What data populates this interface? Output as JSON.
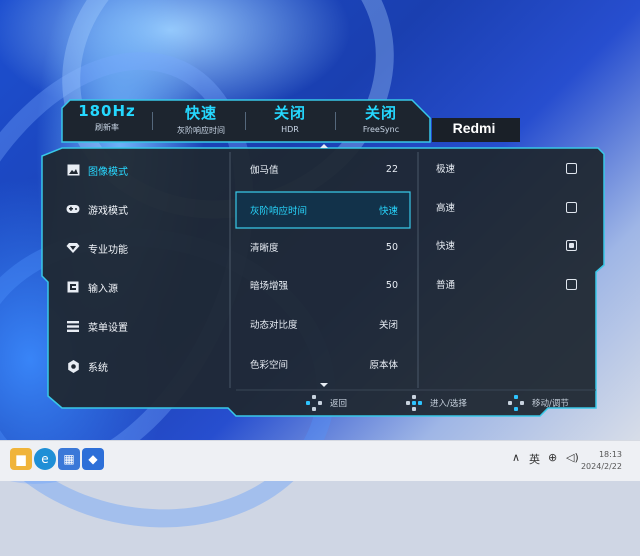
{
  "header_tabs": [
    {
      "value": "180Hz",
      "label": "刷新率"
    },
    {
      "value": "快速",
      "label": "灰阶响应时间"
    },
    {
      "value": "关闭",
      "label": "HDR"
    },
    {
      "value": "关闭",
      "label": "FreeSync"
    }
  ],
  "brand": "Redmi",
  "sidebar": [
    {
      "label": "图像模式",
      "icon": "image-icon",
      "active": true
    },
    {
      "label": "游戏模式",
      "icon": "gamepad-icon",
      "active": false
    },
    {
      "label": "专业功能",
      "icon": "diamond-icon",
      "active": false
    },
    {
      "label": "输入源",
      "icon": "input-source-icon",
      "active": false
    },
    {
      "label": "菜单设置",
      "icon": "menu-icon",
      "active": false
    },
    {
      "label": "系统",
      "icon": "settings-gear-icon",
      "active": false
    }
  ],
  "settings": [
    {
      "label": "伽马值",
      "value": "22"
    },
    {
      "label": "灰阶响应时间",
      "value": "快速"
    },
    {
      "label": "清晰度",
      "value": "50"
    },
    {
      "label": "暗场增强",
      "value": "50"
    },
    {
      "label": "动态对比度",
      "value": "关闭"
    },
    {
      "label": "色彩空间",
      "value": "原本体"
    }
  ],
  "options": [
    {
      "label": "极速",
      "selected": false
    },
    {
      "label": "高速",
      "selected": false
    },
    {
      "label": "快速",
      "selected": true
    },
    {
      "label": "普通",
      "selected": false
    }
  ],
  "hints": [
    {
      "label": "返回"
    },
    {
      "label": "进入/选择"
    },
    {
      "label": "移动/调节"
    }
  ],
  "taskbar": {
    "ime": "英",
    "time": "18:13",
    "date": "2024/2/22"
  },
  "colors": {
    "accent": "#28d8ff",
    "panel": "#1f2731",
    "border": "#38c8e8"
  }
}
